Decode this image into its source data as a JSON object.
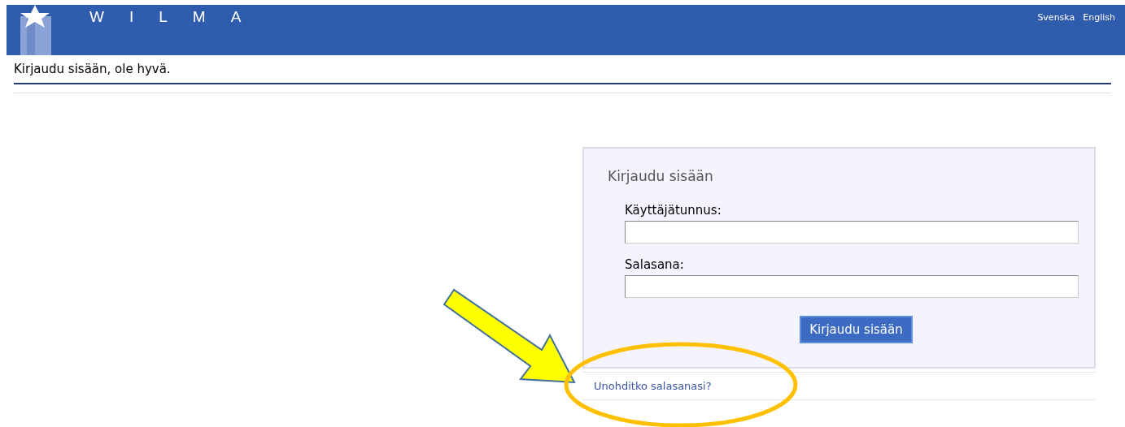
{
  "header": {
    "brand": [
      "W",
      "I",
      "L",
      "M",
      "A"
    ],
    "languages": [
      "Svenska",
      "English"
    ]
  },
  "page_title": "Kirjaudu sisään, ole hyvä.",
  "login": {
    "title": "Kirjaudu sisään",
    "fields": [
      {
        "label": "Käyttäjätunnus:"
      },
      {
        "label": "Salasana:"
      }
    ],
    "submit": "Kirjaudu sisään",
    "forgot_link": "Unohditko salasanasi?"
  }
}
